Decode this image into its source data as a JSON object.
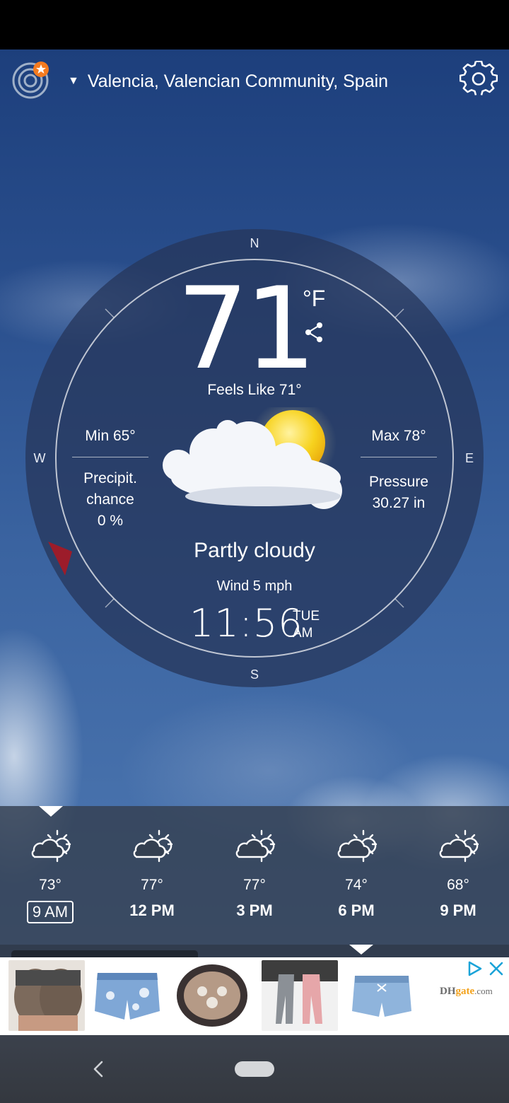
{
  "header": {
    "location": "Valencia, Valencian Community, Spain"
  },
  "current": {
    "temperature": "71",
    "unit": "°F",
    "feels_like": "Feels Like 71°",
    "min": "Min 65°",
    "max": "Max 78°",
    "precip_line1": "Precipit.",
    "precip_line2": "chance",
    "precip_value": "0 %",
    "pressure_label": "Pressure",
    "pressure_value": "30.27 in",
    "condition": "Partly cloudy",
    "wind": "Wind 5 mph",
    "time": "11:56",
    "day": "TUE",
    "ampm": "AM",
    "wind_direction_deg": 250
  },
  "compass": {
    "n": "N",
    "s": "S",
    "e": "E",
    "w": "W"
  },
  "hourly": [
    {
      "temp": "73°",
      "time": "9 AM",
      "icon": "partly-cloudy-icon",
      "selected": true
    },
    {
      "temp": "77°",
      "time": "12 PM",
      "icon": "partly-cloudy-icon",
      "selected": false
    },
    {
      "temp": "77°",
      "time": "3 PM",
      "icon": "partly-cloudy-icon",
      "selected": false
    },
    {
      "temp": "74°",
      "time": "6 PM",
      "icon": "partly-cloudy-icon",
      "selected": false
    },
    {
      "temp": "68°",
      "time": "9 PM",
      "icon": "partly-cloudy-icon",
      "selected": false
    }
  ],
  "ad": {
    "brand_prefix": "DH",
    "brand_mid": "gate",
    "brand_suffix": ".com",
    "products": [
      "denim-shorts-product",
      "ripped-shorts-product",
      "pearl-oyster-product",
      "leggings-product",
      "lace-up-shorts-product"
    ]
  },
  "colors": {
    "accent_orange": "#f47b20",
    "wind_marker_red": "#9c1c2a",
    "panel": "#343f50"
  }
}
